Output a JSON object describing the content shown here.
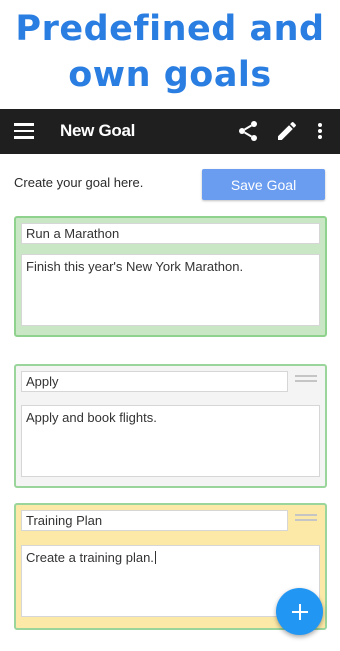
{
  "headline": {
    "line1": "Predefined and",
    "line2": "own goals"
  },
  "appbar": {
    "title": "New Goal",
    "menu_icon": "menu-icon",
    "actions": [
      "share-icon",
      "edit-icon",
      "more-vert-icon"
    ]
  },
  "form": {
    "prompt": "Create your goal here.",
    "save_label": "Save Goal"
  },
  "goals": [
    {
      "title": "Run a Marathon",
      "description": "Finish this year's New York Marathon.",
      "color": "#c9e7c5"
    },
    {
      "title": "Apply",
      "description": "Apply and book flights.",
      "color": "#f4f4f4"
    },
    {
      "title": "Training Plan",
      "description": "Create a training plan.",
      "color": "#fde9a7"
    }
  ],
  "fab": {
    "icon": "add-icon"
  },
  "colors": {
    "accent": "#2a7de1",
    "button": "#6a9df0",
    "fab": "#2196f3",
    "appbar": "#1f1f1f"
  }
}
